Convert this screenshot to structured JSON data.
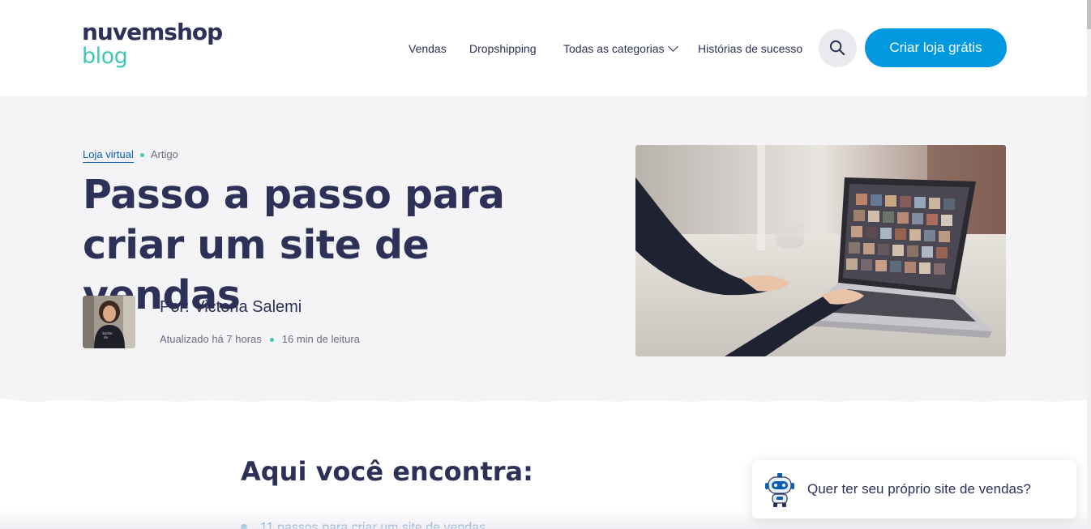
{
  "logo": {
    "top": "nuvemshop",
    "bottom": "blog"
  },
  "nav": {
    "items": [
      {
        "label": "Vendas"
      },
      {
        "label": "Dropshipping"
      },
      {
        "label": "Todas as categorias"
      },
      {
        "label": "Histórias de sucesso"
      }
    ],
    "search_icon": "search-icon",
    "cta_label": "Criar loja grátis"
  },
  "article": {
    "category": "Loja virtual",
    "type": "Artigo",
    "title": "Passo a passo para criar um site de vendas",
    "author": "Por: Victoria Salemi",
    "updated": "Atualizado há 7 horas",
    "reading_time": "16 min de leitura"
  },
  "toc": {
    "title": "Aqui você encontra:",
    "items": [
      "11 passos para criar um site de vendas"
    ]
  },
  "chat": {
    "text": "Quer ter seu próprio site de vendas?",
    "icon": "robot-icon"
  },
  "colors": {
    "brand_dark": "#2d3057",
    "brand_teal": "#3ec7b5",
    "accent_blue": "#0099e0",
    "link": "#0a5fb5",
    "hero_bg": "#f4f4f6"
  }
}
